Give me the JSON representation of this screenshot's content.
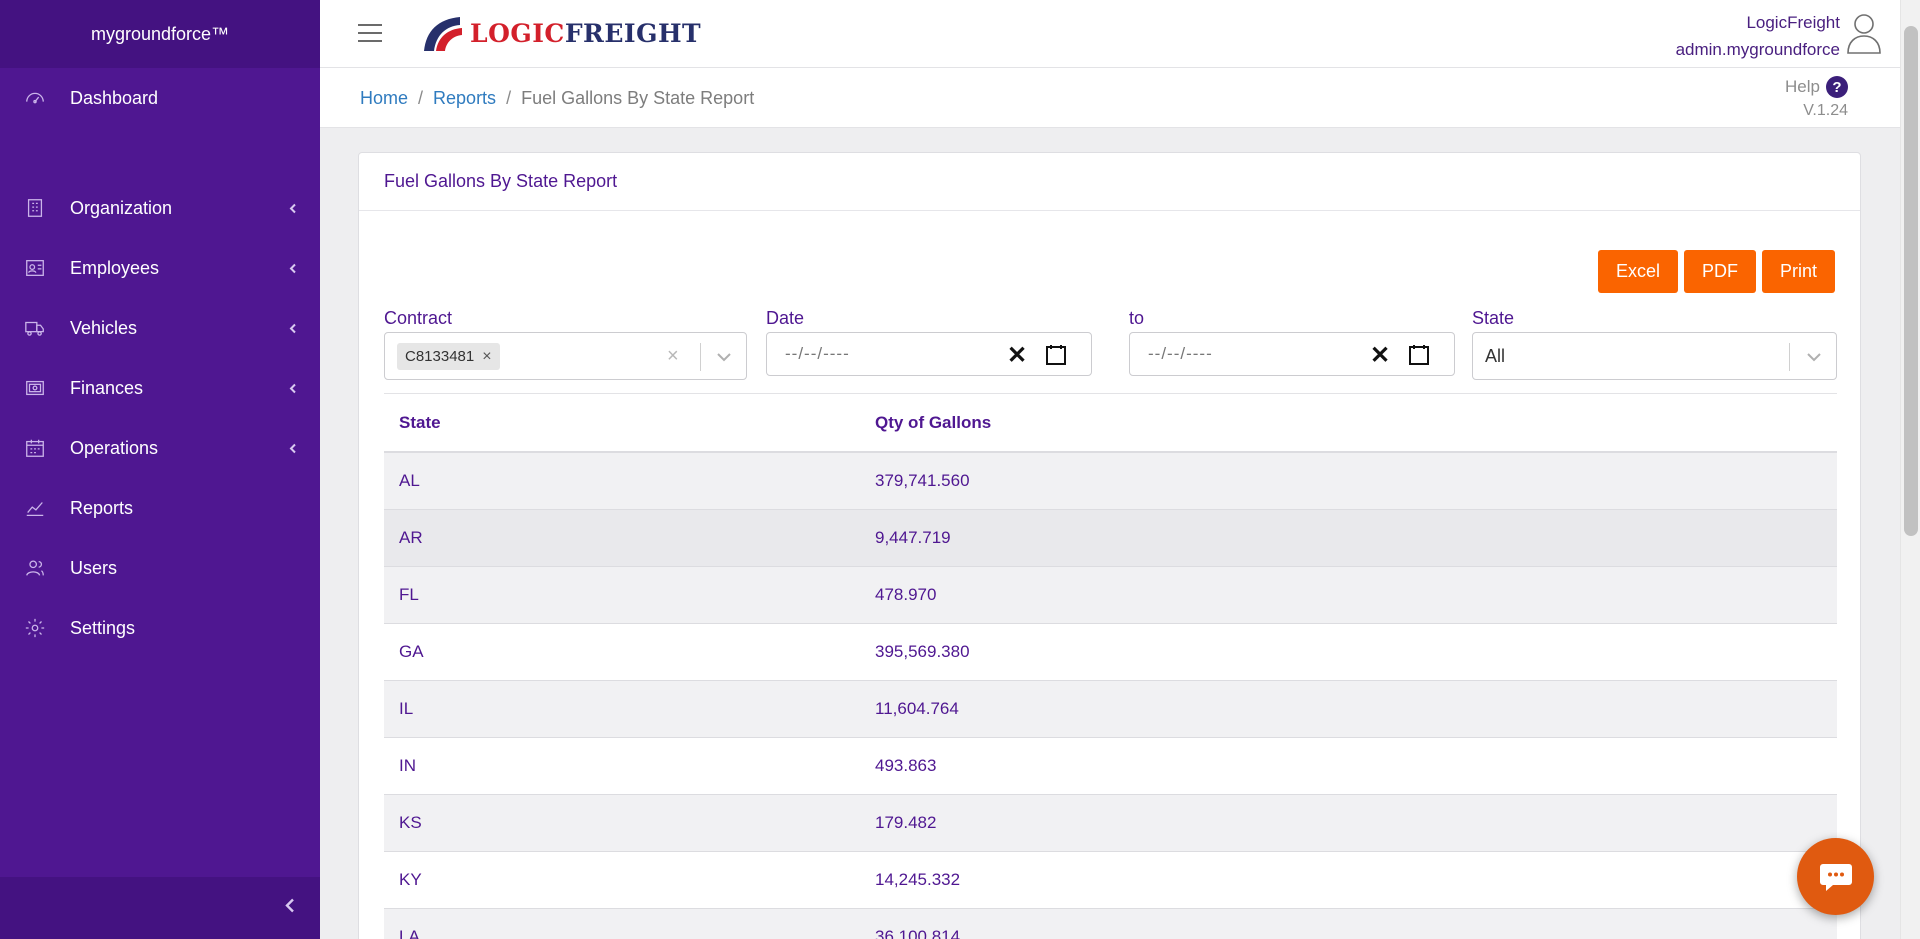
{
  "sidebar": {
    "brand": "mygroundforce™",
    "items": [
      {
        "label": "Dashboard",
        "icon": "gauge-icon",
        "has_children": false
      },
      {
        "label": "Organization",
        "icon": "building-icon",
        "has_children": true
      },
      {
        "label": "Employees",
        "icon": "id-card-icon",
        "has_children": true
      },
      {
        "label": "Vehicles",
        "icon": "truck-icon",
        "has_children": true
      },
      {
        "label": "Finances",
        "icon": "money-icon",
        "has_children": true
      },
      {
        "label": "Operations",
        "icon": "calendar-icon",
        "has_children": true
      },
      {
        "label": "Reports",
        "icon": "chart-line-icon",
        "has_children": false
      },
      {
        "label": "Users",
        "icon": "users-icon",
        "has_children": false
      },
      {
        "label": "Settings",
        "icon": "gear-icon",
        "has_children": false
      }
    ]
  },
  "header": {
    "logo_part1": "LOGIC",
    "logo_part2": "FREIGHT",
    "company": "LogicFreight",
    "username": "admin.mygroundforce"
  },
  "breadcrumb": {
    "home": "Home",
    "sep": "/",
    "reports": "Reports",
    "current": "Fuel Gallons By State Report"
  },
  "help": {
    "label": "Help",
    "icon": "?",
    "version": "V.1.24"
  },
  "card": {
    "title": "Fuel Gallons By State Report",
    "buttons": {
      "excel": "Excel",
      "pdf": "PDF",
      "print": "Print"
    }
  },
  "filters": {
    "contract": {
      "label": "Contract",
      "chip": "C8133481",
      "chip_remove": "×",
      "clear": "×"
    },
    "date_from": {
      "label": "Date",
      "placeholder": "--/--/----"
    },
    "date_to": {
      "label": "to",
      "placeholder": "--/--/----"
    },
    "state": {
      "label": "State",
      "value": "All"
    }
  },
  "table": {
    "headers": [
      "State",
      "Qty of Gallons"
    ],
    "rows": [
      {
        "state": "AL",
        "qty": "379,741.560"
      },
      {
        "state": "AR",
        "qty": "9,447.719"
      },
      {
        "state": "FL",
        "qty": "478.970"
      },
      {
        "state": "GA",
        "qty": "395,569.380"
      },
      {
        "state": "IL",
        "qty": "11,604.764"
      },
      {
        "state": "IN",
        "qty": "493.863"
      },
      {
        "state": "KS",
        "qty": "179.482"
      },
      {
        "state": "KY",
        "qty": "14,245.332"
      },
      {
        "state": "LA",
        "qty": "36,100.814"
      }
    ]
  },
  "colors": {
    "sidebar": "#4f1791",
    "accent_orange": "#fa6400",
    "text_purple": "#4f1791",
    "link_blue": "#2f7bbf"
  }
}
